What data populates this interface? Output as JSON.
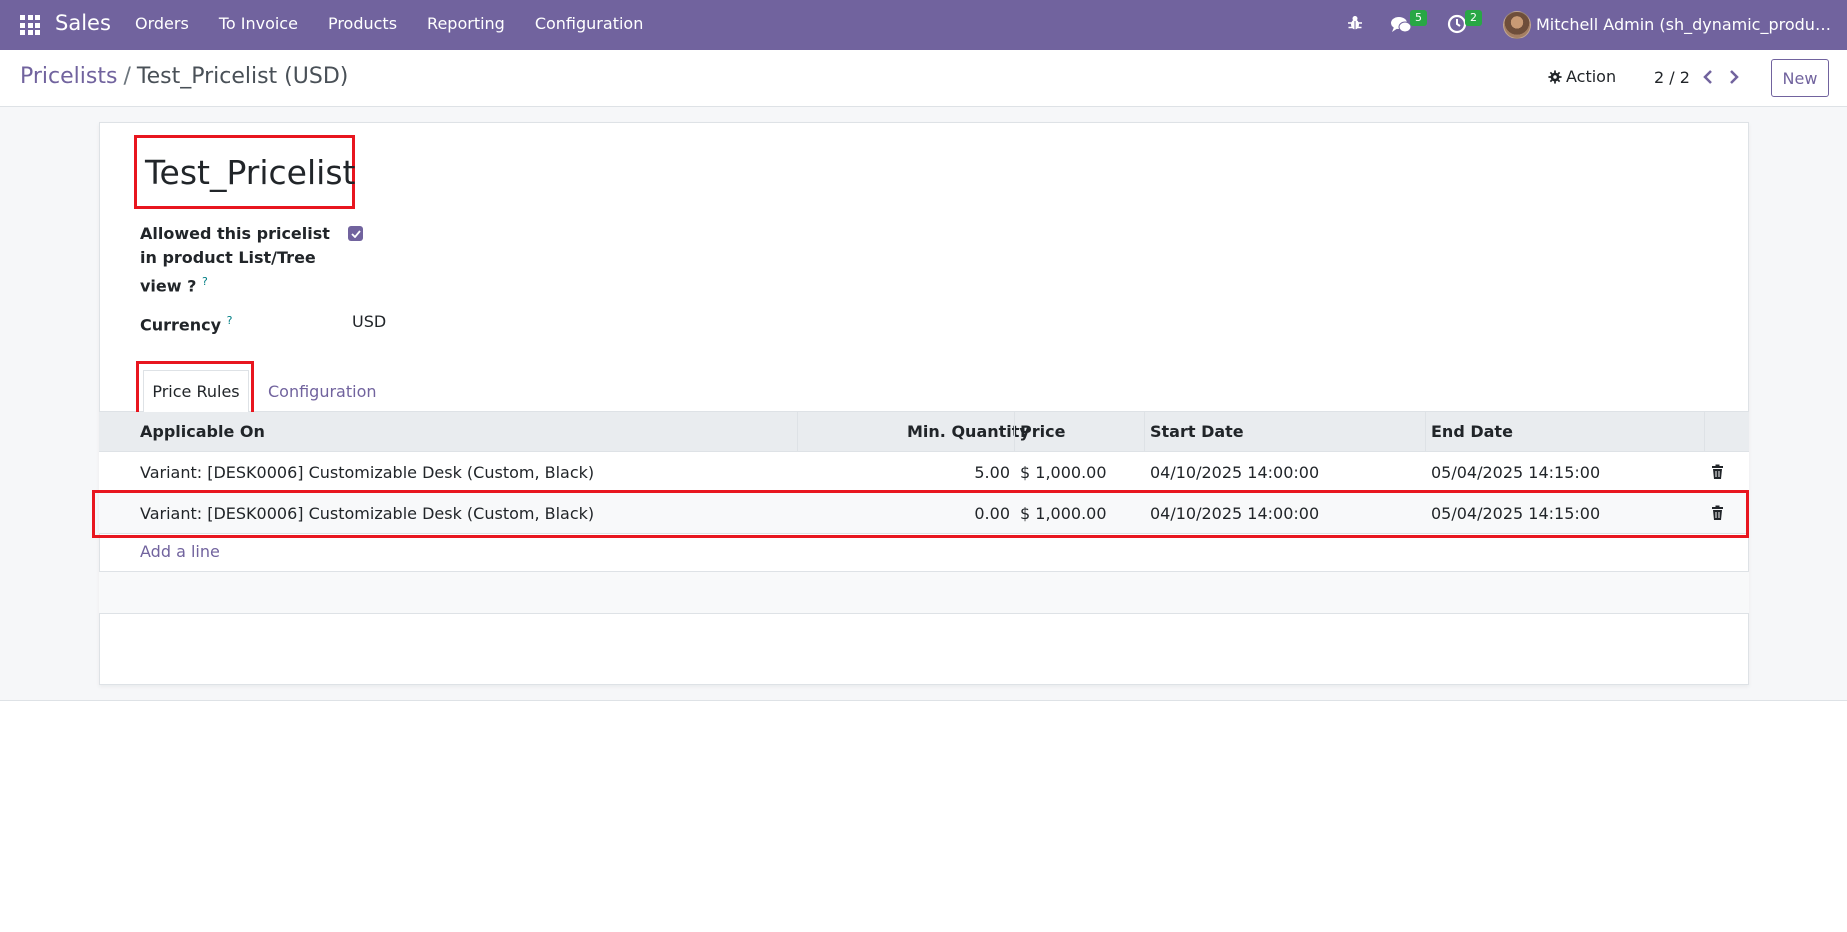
{
  "navbar": {
    "brand": "Sales",
    "menu": [
      "Orders",
      "To Invoice",
      "Products",
      "Reporting",
      "Configuration"
    ],
    "chat_count": "5",
    "activity_count": "2",
    "user": "Mitchell Admin (sh_dynamic_product_..."
  },
  "breadcrumb": {
    "parent": "Pricelists",
    "separator": "/",
    "current": "Test_Pricelist (USD)"
  },
  "toolbar": {
    "action_label": "Action",
    "pager": "2 / 2",
    "new_label": "New"
  },
  "form": {
    "title": "Test_Pricelist",
    "allowed_label": "Allowed this pricelist in product List/Tree view ?",
    "help_mark": "?",
    "allowed_checked": true,
    "currency_label": "Currency",
    "currency_value": "USD"
  },
  "tabs": {
    "price_rules": "Price Rules",
    "configuration": "Configuration"
  },
  "table": {
    "headers": {
      "applicable_on": "Applicable On",
      "min_qty": "Min. Quantity",
      "price": "Price",
      "start_date": "Start Date",
      "end_date": "End Date"
    },
    "rows": [
      {
        "applicable_on": "Variant: [DESK0006] Customizable Desk (Custom, Black)",
        "min_qty": "5.00",
        "price": "$ 1,000.00",
        "start_date": "04/10/2025 14:00:00",
        "end_date": "05/04/2025 14:15:00"
      },
      {
        "applicable_on": "Variant: [DESK0006] Customizable Desk (Custom, Black)",
        "min_qty": "0.00",
        "price": "$ 1,000.00",
        "start_date": "04/10/2025 14:00:00",
        "end_date": "05/04/2025 14:15:00"
      }
    ],
    "add_line": "Add a line"
  },
  "colors": {
    "brand": "#71639e",
    "highlight": "#e8161f",
    "badge": "#28a745"
  }
}
